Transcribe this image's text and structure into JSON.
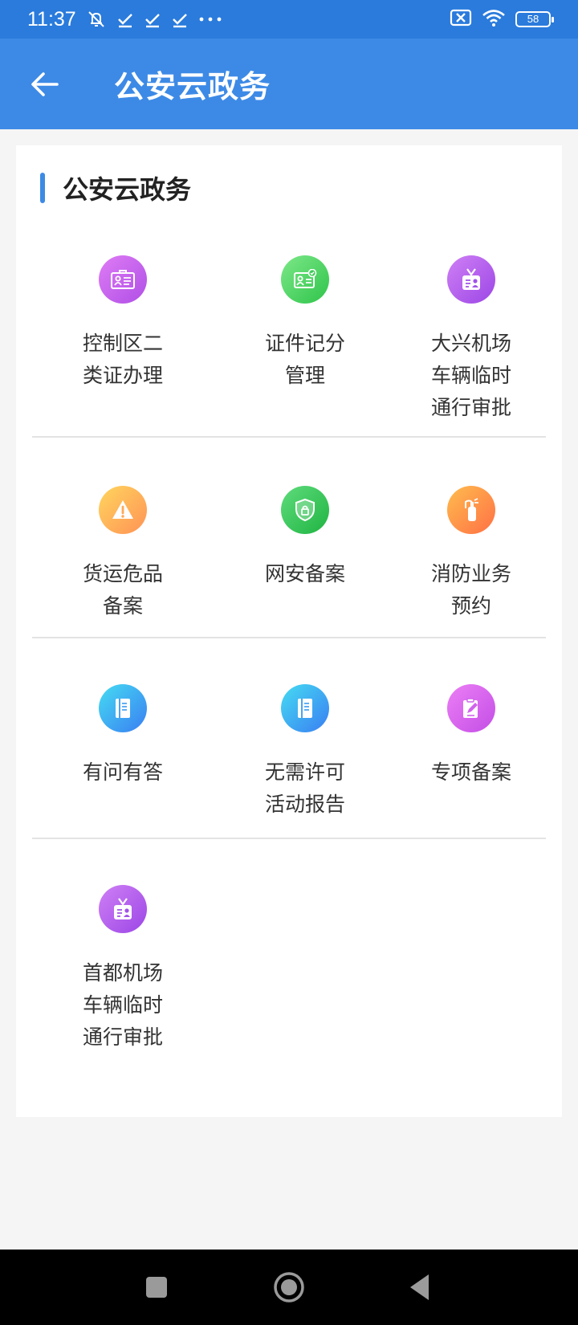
{
  "status_bar": {
    "time": "11:37",
    "battery": "58"
  },
  "header": {
    "title": "公安云政务"
  },
  "section": {
    "title": "公安云政务"
  },
  "rows": [
    [
      {
        "label": "控制区二类证办理",
        "icon": "id-card-icon",
        "color_from": "#d16bf0",
        "color_to": "#b04fe6"
      },
      {
        "label": "证件记分管理",
        "icon": "certified-card-icon",
        "color_from": "#6ee07a",
        "color_to": "#2fc44a"
      },
      {
        "label": "大兴机场车辆临时通行审批",
        "icon": "badge-pass-icon",
        "color_from": "#c672f2",
        "color_to": "#9c46e6"
      }
    ],
    [
      {
        "label": "货运危品备案",
        "icon": "warning-icon",
        "color_from": "#ffcf5a",
        "color_to": "#ff9a55"
      },
      {
        "label": "网安备案",
        "icon": "shield-lock-icon",
        "color_from": "#57d874",
        "color_to": "#23b845"
      },
      {
        "label": "消防业务预约",
        "icon": "fire-extinguisher-icon",
        "color_from": "#ffb24e",
        "color_to": "#ff7a4a"
      }
    ],
    [
      {
        "label": "有问有答",
        "icon": "notebook-icon",
        "color_from": "#3fd4f0",
        "color_to": "#3a86f2"
      },
      {
        "label": "无需许可活动报告",
        "icon": "notebook-icon",
        "color_from": "#3fd4f0",
        "color_to": "#3a86f2"
      },
      {
        "label": "专项备案",
        "icon": "edit-note-icon",
        "color_from": "#e474f0",
        "color_to": "#c44ee6"
      }
    ],
    [
      {
        "label": "首都机场车辆临时通行审批",
        "icon": "badge-pass-icon",
        "color_from": "#c672f2",
        "color_to": "#9c46e6"
      }
    ]
  ]
}
